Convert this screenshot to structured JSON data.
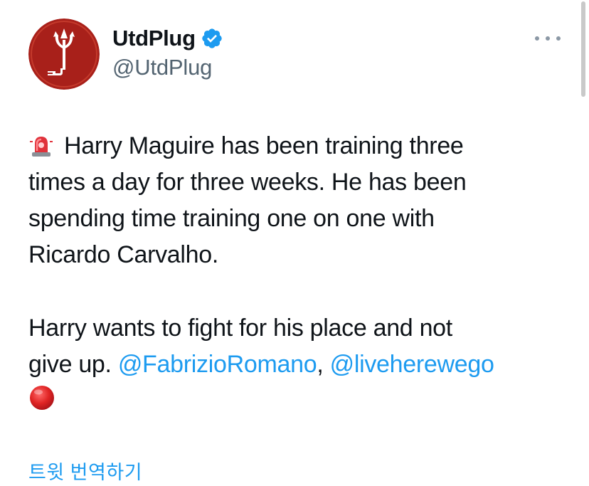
{
  "tweet": {
    "author": {
      "display_name": "UtdPlug",
      "handle": "@UtdPlug",
      "verified": true,
      "avatar_icon": "trident-plug-logo"
    },
    "more_options_icon": "more-horizontal-icon",
    "body": {
      "siren_icon": "police-light-emoji",
      "line1": "Harry Maguire has been training three",
      "line2": "times a day for three weeks. He has been",
      "line3": "spending time training one on one with",
      "line4": "Ricardo Carvalho.",
      "line5": "Harry wants to fight for his place and not",
      "line6_prefix": "give up. ",
      "mention1": "@FabrizioRomano",
      "separator": ", ",
      "mention2": "@liveherewego",
      "end_icon": "red-circle-emoji"
    },
    "translate_label": "트윗 번역하기"
  },
  "colors": {
    "accent": "#1d9bf0",
    "text": "#0f1419",
    "muted": "#536471",
    "avatar_bg": "#a8201a"
  }
}
